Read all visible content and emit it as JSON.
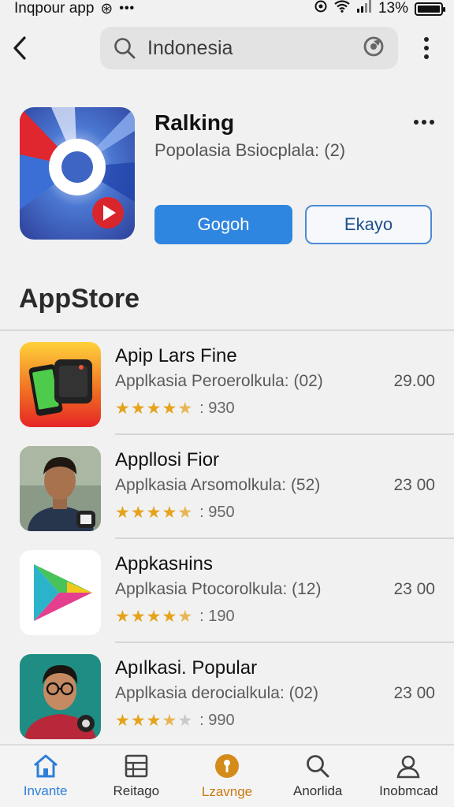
{
  "status_bar": {
    "app_label": "Inqpour app",
    "signal_glyph": "⊛",
    "more_dots": "•••",
    "battery_text": "13%",
    "battery_level": 0.13
  },
  "top_bar": {
    "back_icon": "chevron-left-icon",
    "search_value": "Indonesia",
    "search_icon": "search-icon",
    "refresh_icon": "refresh-icon",
    "more_icon": "kebab-menu-icon"
  },
  "featured": {
    "title": "Ralking",
    "subtitle": "Popolasia Bsiocplala: (2)",
    "primary_button": "Gogoh",
    "secondary_button": "Ekayo"
  },
  "section": {
    "title": "AppStore"
  },
  "apps": [
    {
      "name": "Apip Lars Fine",
      "desc": "Applkasia Peroerolkula: (02)",
      "price": "29.00",
      "rating": 4.5,
      "rating_count": ": 930"
    },
    {
      "name": "Appllosi Fior",
      "desc": "Applkasia Arsomolkula: (52)",
      "price": "23 00",
      "rating": 4.5,
      "rating_count": ": 950"
    },
    {
      "name": "Appkasнins",
      "desc": "Applkasia Ptocorolkula: (12)",
      "price": "23 00",
      "rating": 4.5,
      "rating_count": ": 190"
    },
    {
      "name": "Apılkasi. Popular",
      "desc": "Applkasia derocialkula: (02)",
      "price": "23 00",
      "rating": 3.5,
      "rating_count": ": 990"
    }
  ],
  "bottom_nav": [
    {
      "label": "Invante",
      "icon": "home-icon"
    },
    {
      "label": "Reitago",
      "icon": "grid-list-icon"
    },
    {
      "label": "Lzavnge",
      "icon": "pin-badge-icon"
    },
    {
      "label": "Anorlida",
      "icon": "search-icon"
    },
    {
      "label": "Inobmcad",
      "icon": "profile-icon"
    }
  ],
  "colors": {
    "accent_blue": "#2f86e0",
    "star_gold": "#e5a21b",
    "nav_orange": "#d48b1a"
  }
}
